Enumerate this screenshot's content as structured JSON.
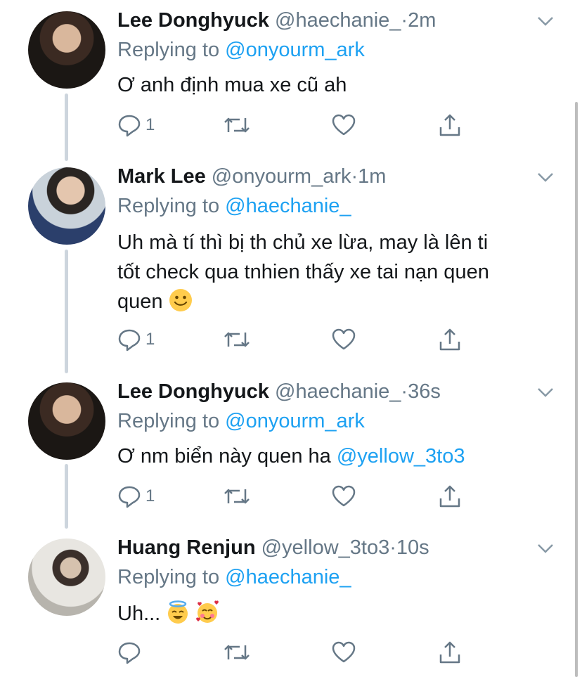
{
  "tweets": [
    {
      "name": "Lee Donghyuck",
      "handle": "@haechanie_",
      "time": "2m",
      "reply_prefix": "Replying to",
      "reply_to": "@onyourm_ark",
      "text_lines": [
        "Ơ anh định mua xe cũ ah"
      ],
      "reply_count": "1"
    },
    {
      "name": "Mark Lee",
      "handle": "@onyourm_ark",
      "time": "1m",
      "reply_prefix": "Replying to",
      "reply_to": "@haechanie_",
      "text_lines": [
        "Uh mà tí thì bị th chủ xe lừa, may là lên ti",
        "tốt check qua tnhien thấy xe tai nạn quen",
        "quen"
      ],
      "reply_count": "1"
    },
    {
      "name": "Lee Donghyuck",
      "handle": "@haechanie_",
      "time": "36s",
      "reply_prefix": "Replying to",
      "reply_to": "@onyourm_ark",
      "text": "Ơ nm biển này quen ha",
      "text_mention": "@yellow_3to3",
      "reply_count": "1"
    },
    {
      "name": "Huang Renjun",
      "handle": "@yellow_3to3",
      "time": "10s",
      "reply_prefix": "Replying to",
      "reply_to": "@haechanie_",
      "text": "Uh...",
      "reply_count": ""
    }
  ],
  "separator": "·",
  "icons": [
    "avatar",
    "chevron-down-icon",
    "reply-icon",
    "retweet-icon",
    "like-icon",
    "share-icon",
    "slightly-smiling-face-emoji",
    "smiling-face-with-halo-emoji",
    "smiling-face-with-hearts-emoji"
  ],
  "colors": {
    "name": "#14171a",
    "secondary": "#657786",
    "link": "#1da1f2",
    "thread_line": "#cdd5dd"
  }
}
